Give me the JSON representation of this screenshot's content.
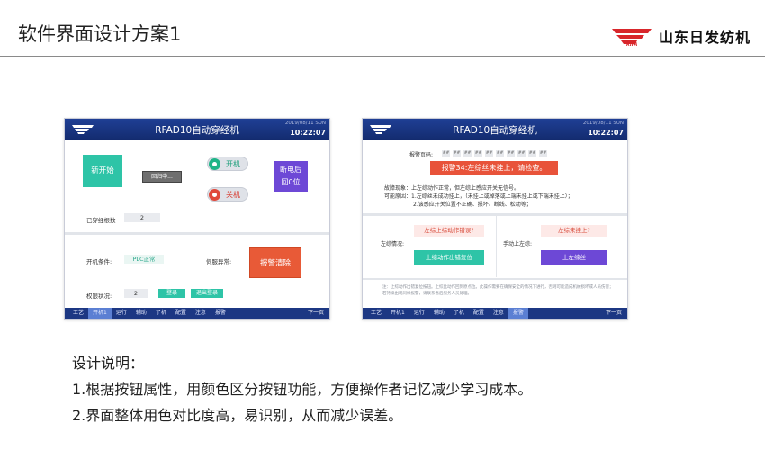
{
  "slide": {
    "title": "软件界面设计方案1",
    "brand_text": "山东日发纺机",
    "brand_mark": "RIFA"
  },
  "screen_common": {
    "app_title": "RFAD10自动穿经机",
    "date": "2019/08/11 SUN",
    "time": "10:22:07",
    "nav": [
      "工艺",
      "开机1",
      "运行",
      "辅助",
      "了机",
      "配置",
      "注意",
      "报警"
    ],
    "next_page": "下一页",
    "logo_text": "RIFA"
  },
  "screen1": {
    "active_nav_index": 1,
    "btn_new_start": "新开始",
    "btn_homing": "回归中...",
    "toggle_on_label": "开机",
    "toggle_off_label": "关机",
    "btn_power_line1": "断电后",
    "btn_power_line2": "回0位",
    "threaded_count_label": "已穿经根数",
    "threaded_count_value": "2",
    "start_condition_label": "开机条件:",
    "start_condition_value": "PLC正常",
    "servo_abnormal_label": "伺服异常:",
    "btn_alarm_clear": "报警清除",
    "permission_label": "权限状况:",
    "permission_value": "2",
    "btn_login": "登录",
    "btn_logout": "退出登录"
  },
  "screen2": {
    "active_nav_index": 7,
    "alarm_code_label": "报警页码:",
    "alarm_codes": [
      "##",
      "##",
      "##",
      "##",
      "##",
      "##",
      "##",
      "##",
      "##",
      "##"
    ],
    "alarm_banner": "报警34:左综丝未挂上，请检查。",
    "fault_line": "故障现象：上左综动作正常，但左综上感应开关无信号。",
    "cause_line1": "可能原因：1.左综丝未成功挂上，（未挂上或掉落或上端未挂上或下端未挂上）；",
    "cause_line2": "2.该感应开关位置不正确、损坏、断线、松动等；",
    "left_status_label": "左综情况:",
    "left_status_value": "左综上综动作错误?",
    "btn_left_reset": "上综动作出错复位",
    "manual_label": "手动上左综:",
    "manual_status_value": "左综未挂上?",
    "btn_manual": "上左综丝",
    "note_text": "注：上综动作出错复位按钮。上综丝动作回到原点位。此操作需要在确保安全的情况下进行，否则可能造成机械损坏或人员伤害；若持续出现同样报警，请联系售后服务人员处理。"
  },
  "description": {
    "title": "设计说明：",
    "line1": "1.根据按钮属性，用颜色区分按钮功能，方便操作者记忆减少学习成本。",
    "line2": "2.界面整体用色对比度高，易识别，从而减少误差。"
  }
}
